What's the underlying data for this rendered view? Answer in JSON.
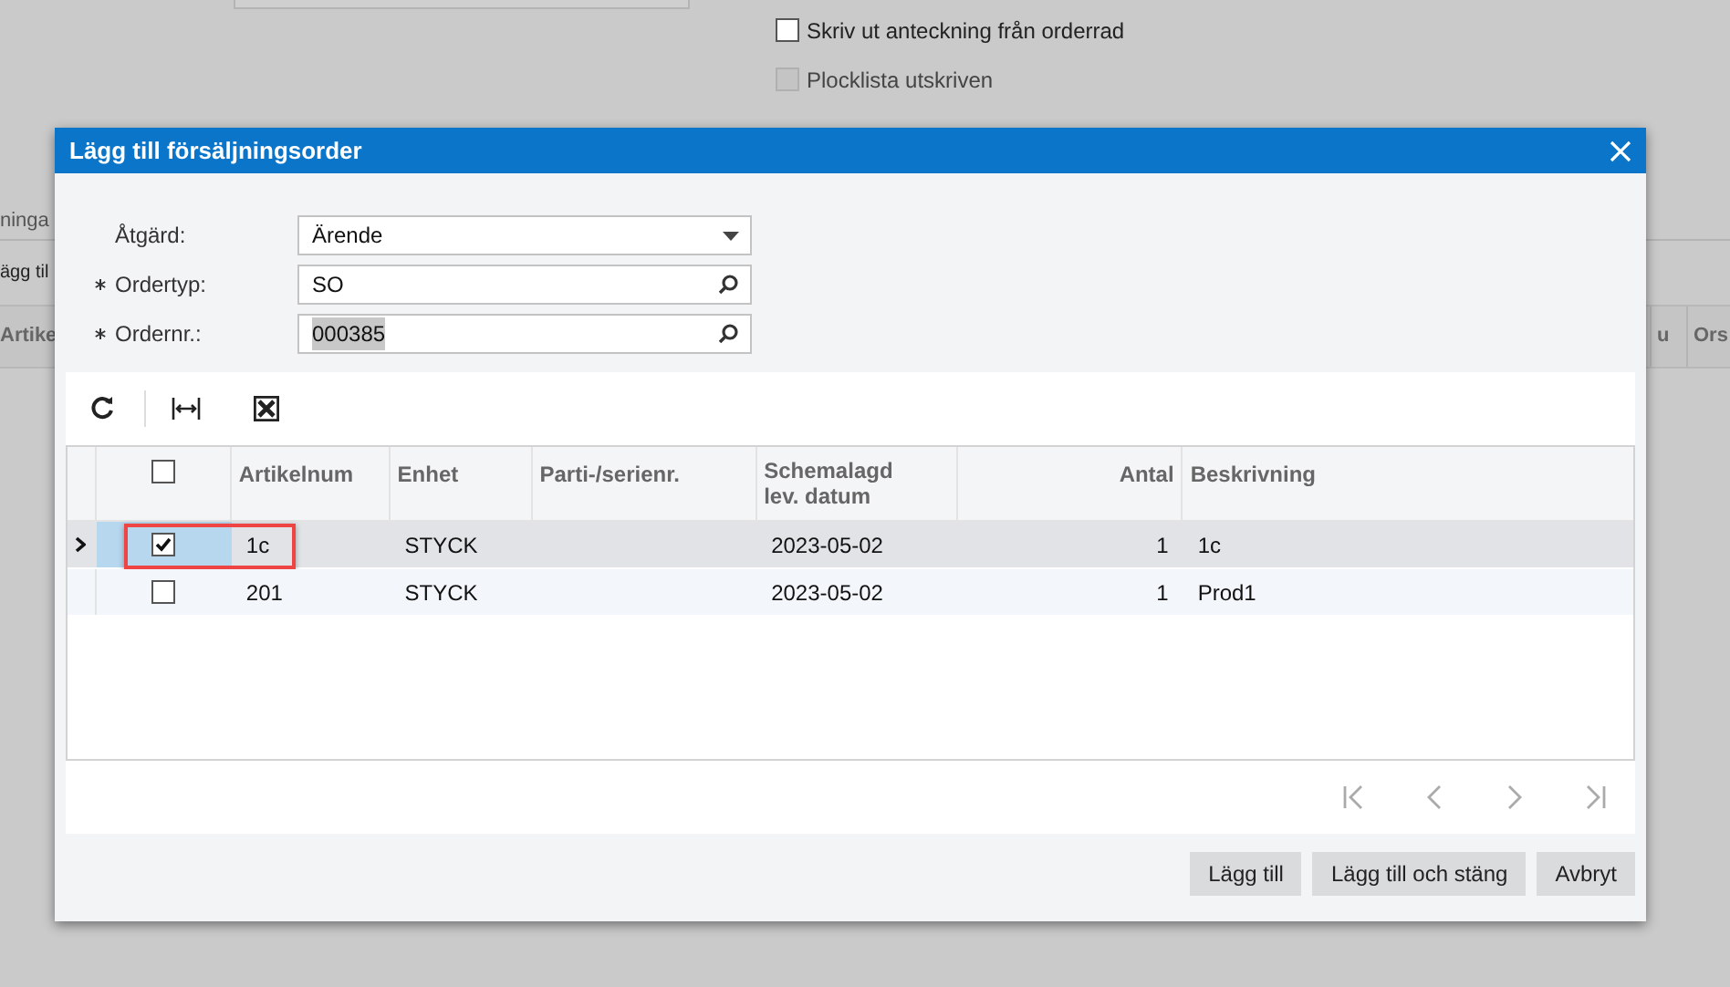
{
  "background": {
    "checkboxes": [
      {
        "label": "Skriv ut anteckning från orderrad",
        "checked": false,
        "disabled": false
      },
      {
        "label": "Plocklista utskriven",
        "checked": false,
        "disabled": true
      }
    ],
    "section_label": "ninga",
    "toolbar_button": "ägg til",
    "grid_columns_left": [
      "Artike"
    ],
    "grid_columns_right": [
      "u",
      "Ors"
    ]
  },
  "dialog": {
    "title": "Lägg till försäljningsorder",
    "fields": [
      {
        "label": "Åtgärd:",
        "required": false,
        "value": "Ärende",
        "kind": "dropdown"
      },
      {
        "label": "Ordertyp:",
        "required": true,
        "value": "SO",
        "kind": "lookup"
      },
      {
        "label": "Ordernr.:",
        "required": true,
        "value": "000385",
        "kind": "lookup",
        "highlighted": true
      }
    ],
    "table": {
      "header_checked": false,
      "columns": [
        {
          "label": "Artikelnum",
          "kind": "text"
        },
        {
          "label": "Enhet",
          "kind": "text"
        },
        {
          "label": "Parti-/serienr.",
          "kind": "text"
        },
        {
          "label": "Schemalagd lev. datum",
          "kind": "text"
        },
        {
          "label": "Antal",
          "kind": "number"
        },
        {
          "label": "Beskrivning",
          "kind": "text"
        }
      ],
      "rows": [
        {
          "selected": true,
          "checked": true,
          "highlighted": true,
          "cells": [
            "1c",
            "STYCK",
            "",
            "2023-05-02",
            "1",
            "1c"
          ]
        },
        {
          "selected": false,
          "checked": false,
          "highlighted": false,
          "cells": [
            "201",
            "STYCK",
            "",
            "2023-05-02",
            "1",
            "Prod1"
          ]
        }
      ]
    },
    "buttons": [
      "Lägg till",
      "Lägg till och stäng",
      "Avbryt"
    ]
  }
}
